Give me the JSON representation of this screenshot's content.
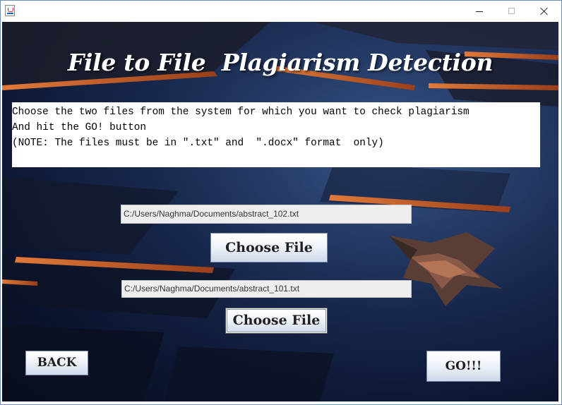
{
  "window": {
    "title": "",
    "controls": {
      "minimize": "minimize-icon",
      "maximize": "maximize-icon",
      "close": "close-icon"
    }
  },
  "header": {
    "title": "File to File  Plagiarism Detection"
  },
  "instructions": {
    "line1": "Choose the two files from the system for which you want to check plagiarism",
    "line2": "And hit the GO! button",
    "line3": "(NOTE: The files must be in \".txt\" and  \".docx\" format  only)"
  },
  "file1": {
    "path": "C:/Users/Naghma/Documents/abstract_102.txt",
    "button_label": "Choose File"
  },
  "file2": {
    "path": "C:/Users/Naghma/Documents/abstract_101.txt",
    "button_label": "Choose File"
  },
  "actions": {
    "back_label": "BACK",
    "go_label": "GO!!!"
  },
  "colors": {
    "background_dark": "#0c1530",
    "accent_stripe": "#c8602a",
    "title_text": "#ffffff"
  }
}
